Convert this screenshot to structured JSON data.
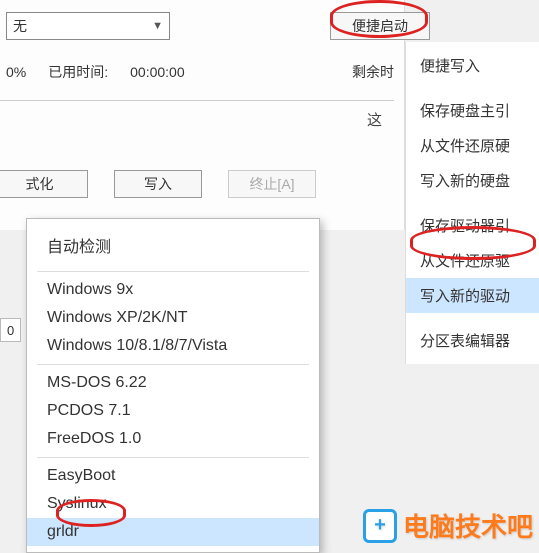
{
  "combo": {
    "value": "无"
  },
  "topButton": "便捷启动",
  "status": {
    "percent": "0%",
    "elapsedLabel": "已用时间:",
    "elapsedValue": "00:00:00",
    "remainLabel": "剩余时"
  },
  "dialogChar": "这",
  "buttons": {
    "format": "式化",
    "write": "写入",
    "abort": "终止[A]"
  },
  "tinyValue": "0",
  "rightMenu": {
    "items": [
      "便捷写入",
      "保存硬盘主引",
      "从文件还原硬",
      "写入新的硬盘",
      "保存驱动器引",
      "从文件还原驱",
      "写入新的驱动",
      "分区表编辑器"
    ]
  },
  "leftMenu": {
    "header": "自动检测",
    "groups": [
      [
        "Windows 9x",
        "Windows XP/2K/NT",
        "Windows 10/8.1/8/7/Vista"
      ],
      [
        "MS-DOS 6.22",
        "PCDOS 7.1",
        "FreeDOS 1.0"
      ],
      [
        "EasyBoot",
        "Syslinux",
        "grldr"
      ]
    ]
  },
  "watermark": "电脑技术吧"
}
